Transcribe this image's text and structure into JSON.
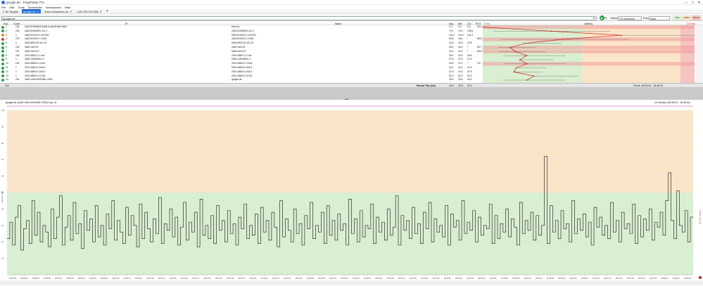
{
  "window": {
    "title": "google.de - PingPlotter Pro",
    "controls": [
      "–",
      "□",
      "✕"
    ]
  },
  "menu": [
    "File",
    "Edit",
    "Tools",
    "Summaries",
    "Workspaces",
    "Help"
  ],
  "tabs": [
    {
      "label": "All Targets",
      "active": false
    },
    {
      "label": "google.de",
      "active": true
    },
    {
      "label": "www.crazyfaces.de",
      "active": false
    },
    {
      "label": "145.239.149.188",
      "active": false
    }
  ],
  "toolbar": {
    "target": "google.de",
    "interval_label": "Interval:",
    "interval_value": "2.5 seconds",
    "focus_label": "Focus:",
    "focus_value": "Auto",
    "legend": [
      "0ms",
      "100ms",
      "200ms"
    ]
  },
  "columns": {
    "hop": "Hop",
    "count": "Count",
    "ip": "IP",
    "name": "Name",
    "avg": "Avg",
    "min": "Min",
    "cur": "Cur",
    "pl": "PL%",
    "latency": "Latency",
    "lat0": "0 ms",
    "latmax": "216 ms"
  },
  "hops": [
    {
      "hop": "1",
      "count": "244",
      "ip": "2a02:8109:8b00:5d46:d,b3a:fff:fe6c:ebb1",
      "name": "fritz.box",
      "avg": "0.4",
      "min": "0.0",
      "cur": "0.4",
      "pl": "69.4",
      "status": "g"
    },
    {
      "hop": "2",
      "count": "244",
      "ip": "2a02:8108:8001:16::1",
      "name": "2a02:8108:8001:16::1",
      "avg": "70.1",
      "min": "10.9",
      "cur": "193.6",
      "pl": "",
      "status": "g"
    },
    {
      "hop": "3",
      "count": "1",
      "ip": "2a02:8100:6:2::101:531",
      "name": "2a02:8100:6:2::101:531",
      "avg": "141.2",
      "min": "141.2",
      "cur": "141.2",
      "pl": "",
      "status": "o"
    },
    {
      "hop": "4",
      "count": "278",
      "ip": "2a02:8100:6:2::2:406",
      "name": "2a02:8100:6:2::2:406",
      "avg": "80.8",
      "min": "18.4",
      "cur": "*",
      "pl": "88.8",
      "status": "r"
    },
    {
      "hop": "5",
      "count": "1",
      "ip": "2a00:6ff0:0:2f::d1:1:5",
      "name": "2a00:6ff0:0:2f::d1:1:5",
      "avg": "42.8",
      "min": "42.8",
      "cur": "42.8",
      "pl": "",
      "status": "g"
    },
    {
      "hop": "6",
      "count": "242",
      "ip": "2a00:1a0:0:5",
      "name": "2a00:1a0:0:5",
      "avg": "28.0",
      "min": "16.0",
      "cur": "*",
      "pl": "69.7",
      "status": "g"
    },
    {
      "hop": "7",
      "count": "237",
      "ip": "2a00:1a0:0:27",
      "name": "2a00:1a0:0:27",
      "avg": "33.4",
      "min": "16.3",
      "cur": "*",
      "pl": "88.8",
      "status": "g"
    },
    {
      "hop": "8",
      "count": "244",
      "ip": "2001:4860:1:1::1a4",
      "name": "2001:4860:1:1::1a4",
      "avg": "45.0",
      "min": "20.8",
      "cur": "39.6",
      "pl": "",
      "status": "g"
    },
    {
      "hop": "9",
      "count": "1",
      "ip": "2a00:1450:80b0::1",
      "name": "2a00:1450:80b0::1",
      "avg": "37.8",
      "min": "37.8",
      "cur": "37.8",
      "pl": "",
      "status": "g"
    },
    {
      "hop": "10",
      "count": "244",
      "ip": "2001:4860:0:1:21a2",
      "name": "2001:4860:0:1:21a2",
      "avg": "44.9",
      "min": "22.1",
      "cur": "*",
      "pl": "0.8",
      "status": "g"
    },
    {
      "hop": "11",
      "count": "1",
      "ip": "2001:4860:0:12eb:3",
      "name": "2001:4860:0:12eb:3",
      "avg": "34.2",
      "min": "34.2",
      "cur": "34.2",
      "pl": "",
      "status": "g"
    },
    {
      "hop": "12",
      "count": "1",
      "ip": "2001:4860:0:12a3:1",
      "name": "2001:4860:0:12a3:1",
      "avg": "31.8",
      "min": "31.8",
      "cur": "31.8",
      "pl": "",
      "status": "g"
    },
    {
      "hop": "13",
      "count": "1",
      "ip": "2001:4860:0:1:27a3",
      "name": "2001:4860:0:1:27a3",
      "avg": "52.3",
      "min": "52.3",
      "cur": "52.3",
      "pl": "",
      "status": "g"
    },
    {
      "hop": "14",
      "count": "244",
      "ip": "2a00:1450:4005:80b::2003",
      "name": "google.de",
      "avg": "45.0",
      "min": "20.8",
      "cur": "40.4",
      "pl": "",
      "status": "g"
    }
  ],
  "summary": {
    "hop": "244",
    "label": "Round Trip (ms)",
    "avg": "45.0",
    "min": "20.8",
    "cur": "40.4",
    "focus": "Focus: 18:09:24 - 18:48:24"
  },
  "graph": {
    "title": "google.de (2a00:1450:4005:80b::2003) hop 14",
    "range": "10 minutes (18:38:24 - 18:48:24)",
    "ylabel": "Latency (ms)",
    "ylabel_right": "Packet Loss %",
    "yticks": [
      "100",
      "90",
      "80",
      "70",
      "60",
      "50",
      "40",
      "30",
      "20",
      "10"
    ],
    "xticks": [
      "18:38:30",
      "18:38:40",
      "18:38:50",
      "18:39:00",
      "18:39:10",
      "18:39:20",
      "18:39:30",
      "18:39:40",
      "18:39:50",
      "18:40:00",
      "18:40:10",
      "18:40:20",
      "18:40:30",
      "18:40:40",
      "18:40:50",
      "18:41:00",
      "18:41:10",
      "18:41:20",
      "18:41:30",
      "18:41:40",
      "18:41:50",
      "18:42:00",
      "18:42:10",
      "18:42:20",
      "18:42:30",
      "18:42:40",
      "18:42:50",
      "18:43:00",
      "18:43:10",
      "18:43:20",
      "18:43:30",
      "18:43:40",
      "18:43:50",
      "18:44:00",
      "18:44:10",
      "18:44:20",
      "18:44:30",
      "18:44:40",
      "18:44:50",
      "18:45:00",
      "18:45:10",
      "18:45:20",
      "18:45:30",
      "18:45:40",
      "18:45:50",
      "18:46:00",
      "18:46:10",
      "18:46:20",
      "18:46:30",
      "18:46:40",
      "18:46:50",
      "18:47:00",
      "18:47:10",
      "18:47:20",
      "18:47:30",
      "18:47:40",
      "18:47:50",
      "18:48:00",
      "18:48:10",
      "18:48:20"
    ],
    "bands": {
      "green_max": 50,
      "yellow_max": 100
    }
  },
  "chart_data": {
    "type": "line",
    "xlabel": "",
    "ylabel": "Latency (ms)",
    "ylim": [
      0,
      100
    ],
    "series": [
      {
        "values": [
          22,
          32,
          18,
          35,
          42,
          15,
          28,
          33,
          19,
          45,
          24,
          38,
          20,
          30,
          26,
          17,
          40,
          22,
          35,
          48,
          18,
          29,
          36,
          21,
          44,
          25,
          31,
          16,
          39,
          27,
          34,
          20,
          42,
          23,
          30,
          18,
          37,
          28,
          45,
          21,
          33,
          26,
          19,
          41,
          24,
          36,
          30,
          17,
          43,
          22,
          38,
          28,
          20,
          34,
          25,
          47,
          19,
          31,
          27,
          40,
          23,
          35,
          18,
          29,
          44,
          21,
          32,
          26,
          38,
          17,
          46,
          24,
          30,
          22,
          36,
          19,
          42,
          27,
          33,
          20,
          39,
          25,
          31,
          18,
          35,
          28,
          43,
          22,
          30,
          24,
          37,
          19,
          41,
          26,
          33,
          21,
          38,
          29,
          17,
          45,
          23,
          34,
          27,
          20,
          40,
          25,
          31,
          18,
          36,
          28,
          44,
          22,
          30,
          26,
          38,
          19,
          42,
          24,
          33,
          21,
          37,
          27,
          31,
          18,
          46,
          25,
          34,
          20,
          39,
          23,
          30,
          28,
          43,
          19,
          35,
          26,
          32,
          21,
          40,
          24,
          29,
          48,
          18,
          36,
          27,
          33,
          22,
          41,
          25,
          31,
          19,
          38,
          28,
          44,
          20,
          34,
          26,
          30,
          23,
          42,
          18,
          37,
          29,
          33,
          21,
          45,
          25,
          32,
          27,
          39,
          20,
          35,
          24,
          30,
          28,
          43,
          19,
          36,
          22,
          31,
          26,
          40,
          23,
          34,
          29,
          18,
          44,
          25,
          33,
          27,
          38,
          21,
          36,
          24,
          30,
          72,
          19,
          42,
          26,
          33,
          22,
          39,
          28,
          31,
          20,
          45,
          25,
          34,
          27,
          37,
          23,
          32,
          18,
          41,
          29,
          35,
          24,
          30,
          22,
          44,
          26,
          33,
          20,
          38,
          28,
          31,
          25,
          43,
          19,
          36,
          23,
          34,
          27,
          40,
          21,
          32,
          29,
          38,
          24,
          45,
          62,
          33,
          22,
          51,
          30,
          26,
          39,
          20,
          35
        ]
      }
    ]
  }
}
